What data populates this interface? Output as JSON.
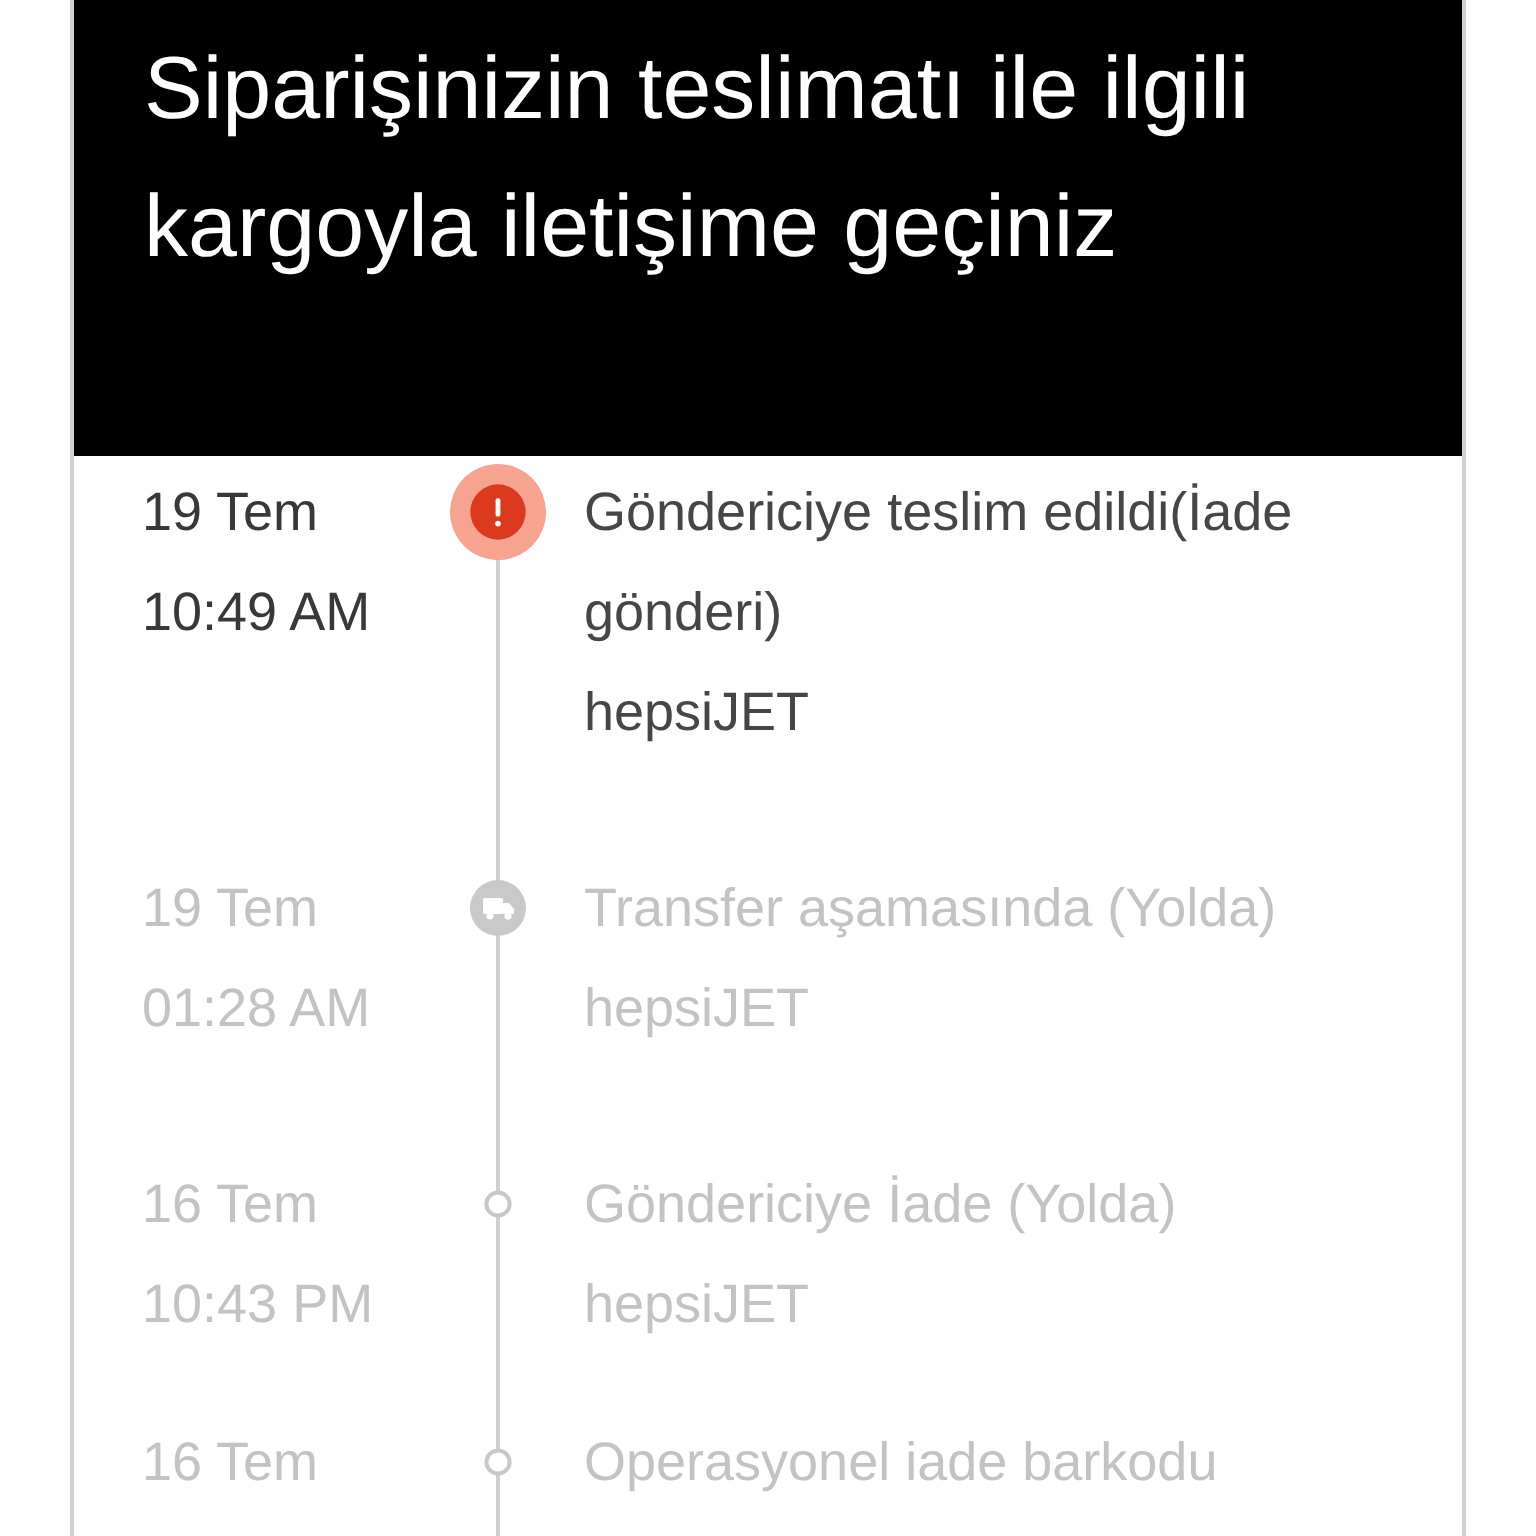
{
  "header": {
    "title": "Siparişinizin teslimatı ile ilgili kargoyla iletişime geçiniz"
  },
  "timeline": [
    {
      "date": "19 Tem",
      "time": "10:49 AM",
      "kind": "alert",
      "active": true,
      "status": "Göndericiye teslim edildi(İade gönderi)",
      "carrier": "hepsiJET"
    },
    {
      "date": "19 Tem",
      "time": "01:28 AM",
      "kind": "truck",
      "active": false,
      "status": "Transfer aşamasında (Yolda)",
      "carrier": "hepsiJET"
    },
    {
      "date": "16 Tem",
      "time": "10:43 PM",
      "kind": "dot",
      "active": false,
      "status": "Göndericiye İade (Yolda)",
      "carrier": "hepsiJET"
    },
    {
      "date": "16 Tem",
      "kind": "dot",
      "active": false,
      "status": "Operasyonel iade barkodu"
    }
  ]
}
